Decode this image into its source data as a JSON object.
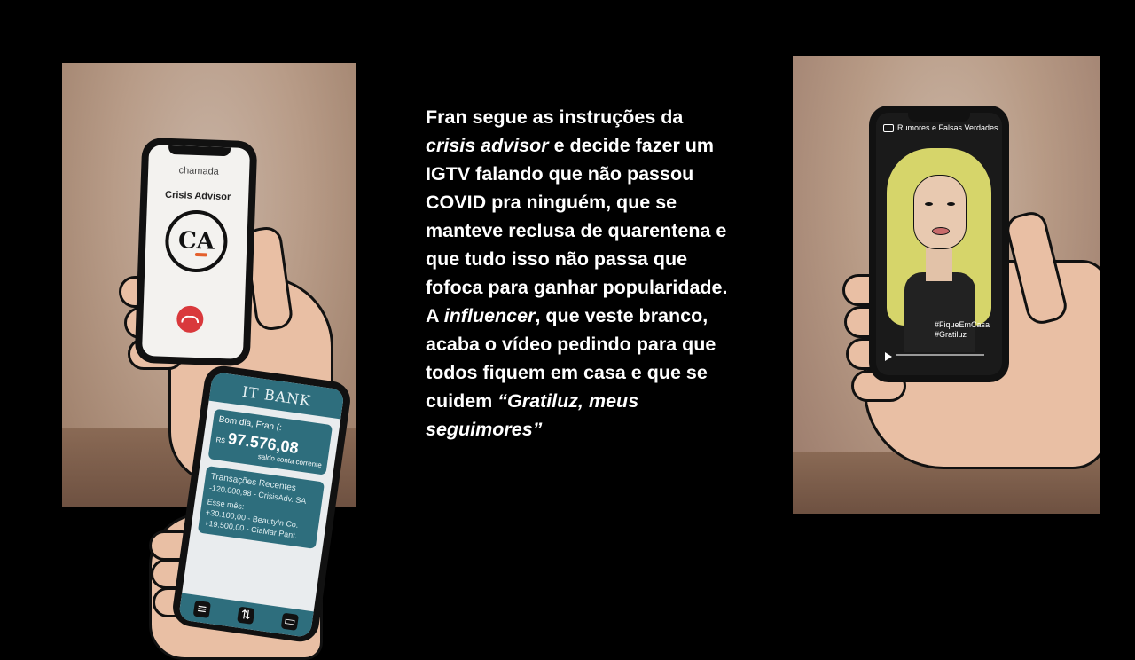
{
  "left_phone": {
    "call_label": "chamada",
    "caller_name": "Crisis Advisor",
    "logo_letters": "CA"
  },
  "bank_phone": {
    "bank_name": "IT BANK",
    "greeting": "Bom dia, Fran (:",
    "currency": "R$",
    "balance": "97.576,08",
    "balance_label": "saldo conta corrente",
    "recent_title": "Transações Recentes",
    "recent_item": "-120.000,98 - CrisisAdv. SA",
    "month_title": "Esse mês:",
    "month_item_1": "+30.100,00 - BeautyIn Co.",
    "month_item_2": "+19.500,00 - CiaMar Pant."
  },
  "story": {
    "p1": "Fran segue as instruções da",
    "p2_em": "crisis advisor",
    "p2": " e decide fazer um IGTV falando que não passou COVID pra ninguém, que se manteve reclusa de quarentena e que tudo isso não passa que fofoca para ganhar popularidade. A ",
    "p3_em": "influencer",
    "p3": ", que veste branco, acaba o vídeo pedindo para que todos fiquem em casa e que se cuidem ",
    "p4_em": "“Gratiluz, meus seguimores”"
  },
  "video_phone": {
    "channel": "Rumores e Falsas Verdades",
    "hashtag_1": "#FiqueEmCasa",
    "hashtag_2": "#Gratiluz"
  },
  "colors": {
    "bank_teal": "#2e6e7d",
    "hangup_red": "#d9393c",
    "hair_yellow": "#d6d56a"
  },
  "icons": [
    "hangup-phone-icon",
    "tv-icon",
    "sliders-icon",
    "transfer-icon",
    "card-icon",
    "play-icon"
  ]
}
